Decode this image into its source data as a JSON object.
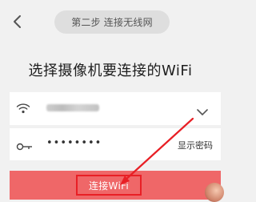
{
  "header": {
    "back_icon": "chevron-left-icon",
    "step_title": "第二步 连接无线网"
  },
  "main": {
    "heading": "选择摄像机要连接的WiFi"
  },
  "wifi_field": {
    "icon": "wifi-icon",
    "ssid_obscured": true,
    "dropdown_icon": "chevron-down-icon"
  },
  "password_field": {
    "icon": "key-icon",
    "masked_value": "••••••••",
    "show_password_label": "显示密码"
  },
  "connect": {
    "label": "连接WiFi"
  },
  "annotation": {
    "arrow_color": "#e81f25",
    "highlight_color": "#e81f25"
  },
  "colors": {
    "background": "#f1f1f1",
    "button": "#ef6768",
    "text": "#1e1e1e"
  }
}
